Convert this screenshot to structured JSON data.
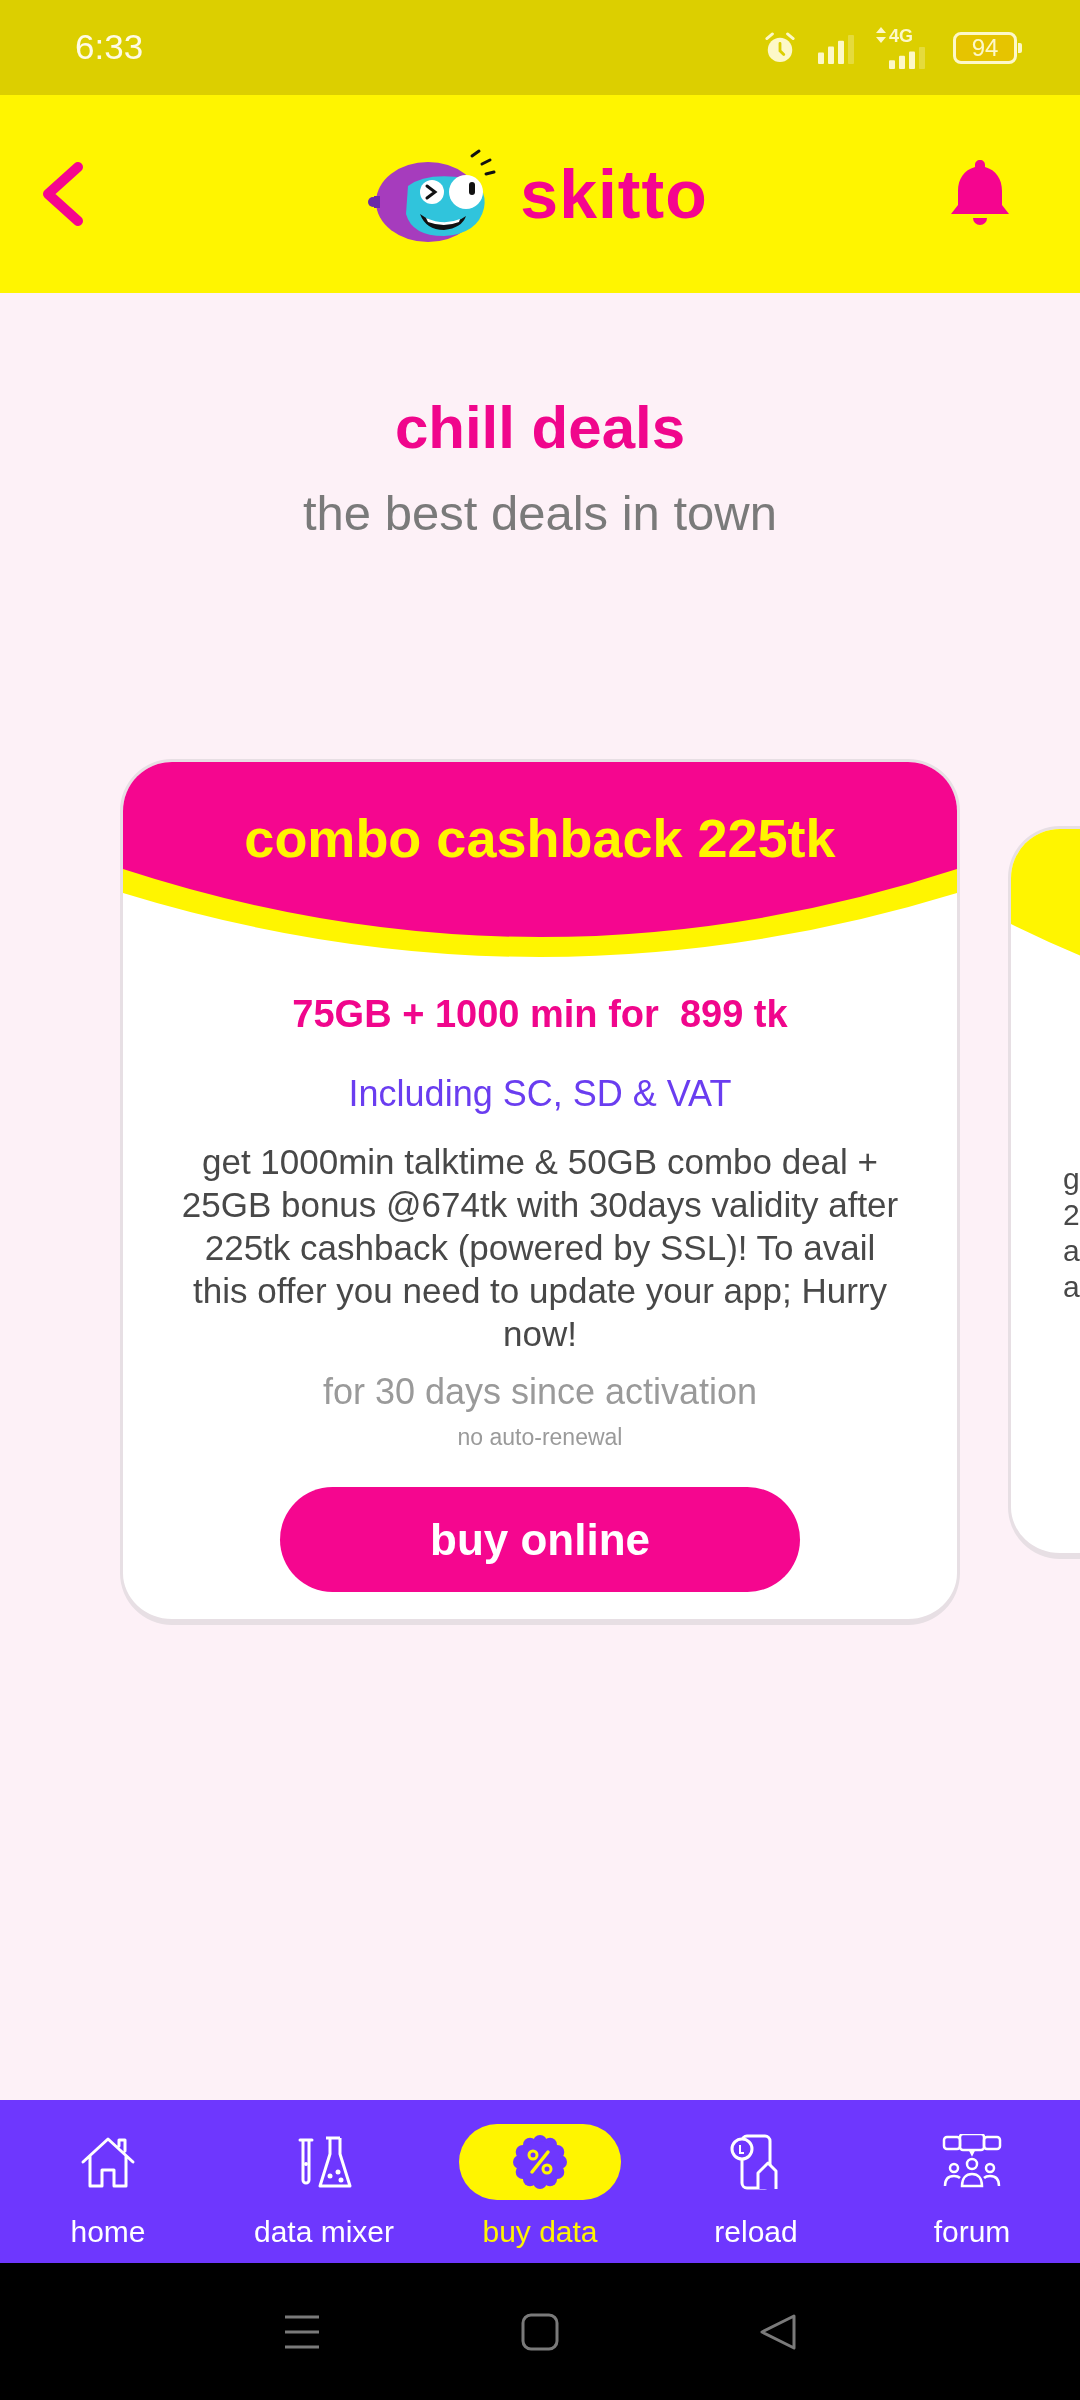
{
  "status_bar": {
    "time": "6:33",
    "network": "4G",
    "battery": "94"
  },
  "header": {
    "logo": "skitto"
  },
  "intro": {
    "title": "chill deals",
    "subtitle": "the best deals in town"
  },
  "offers": [
    {
      "kind": "full",
      "title": "combo cashback 225tk",
      "price": "75GB + 1000 min for  899 tk",
      "tax_note": "Including SC, SD & VAT",
      "description": "get 1000min talktime & 50GB combo deal + 25GB bonus @674tk with 30days validity after 225tk cashback (powered by SSL)! To avail this offer you need to update your app; Hurry now!",
      "validity": "for 30 days since activation",
      "renewal": "no auto-renewal",
      "button": "buy online"
    },
    {
      "kind": "peek",
      "text_lines": [
        "g",
        "2",
        "a",
        "a"
      ]
    }
  ],
  "bottom_nav": [
    {
      "label": "home",
      "selected": false
    },
    {
      "label": "data mixer",
      "selected": false
    },
    {
      "label": "buy data",
      "selected": true
    },
    {
      "label": "reload",
      "selected": false
    },
    {
      "label": "forum",
      "selected": false
    }
  ]
}
